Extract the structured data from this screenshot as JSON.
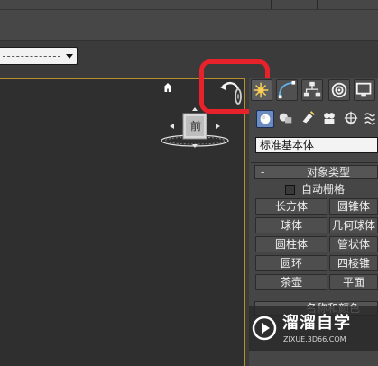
{
  "panel": {
    "category_value": "标准基本体",
    "rollout_object_type": {
      "toggle": "-",
      "title": "对象类型"
    },
    "auto_grid_label": "自动栅格",
    "buttons": [
      "长方体",
      "圆锥体",
      "球体",
      "几何球体",
      "圆柱体",
      "管状体",
      "圆环",
      "四棱锥",
      "茶壶",
      "平面"
    ],
    "next_rollout_title": "名称和颜色"
  },
  "viewcube": {
    "face_label": "前"
  },
  "tabs": [
    "create-tab",
    "modify-tab",
    "hierarchy-tab",
    "motion-tab",
    "display-tab"
  ],
  "subcategories": [
    "geometry-icon",
    "shapes-icon",
    "lights-icon",
    "cameras-icon",
    "helpers-icon",
    "spacewarps-icon"
  ],
  "colors": {
    "viewport_border": "#b58f2e",
    "highlight": "#e8222a",
    "active_subcategory": "#6a8cc0"
  },
  "watermark": {
    "title": "溜溜自学",
    "url": "ZIXUE.3D66.COM"
  }
}
